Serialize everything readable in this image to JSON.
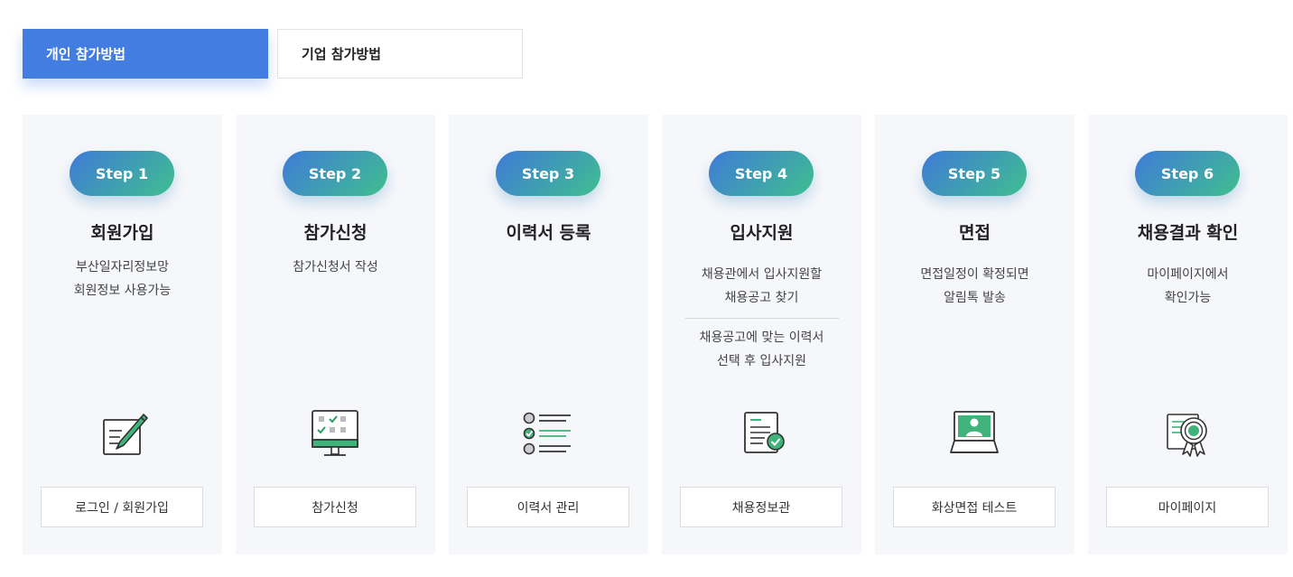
{
  "tabs": {
    "individual": "개인 참가방법",
    "company": "기업 참가방법"
  },
  "steps": [
    {
      "step": "Step 1",
      "title": "회원가입",
      "desc": [
        "부산일자리정보망",
        "회원정보 사용가능"
      ],
      "icon": "pencil-form-icon",
      "button": "로그인 / 회원가입"
    },
    {
      "step": "Step 2",
      "title": "참가신청",
      "desc": [
        "참가신청서 작성"
      ],
      "icon": "monitor-checklist-icon",
      "button": "참가신청"
    },
    {
      "step": "Step 3",
      "title": "이력서 등록",
      "desc": [],
      "icon": "checklist-icon",
      "button": "이력서 관리"
    },
    {
      "step": "Step 4",
      "title": "입사지원",
      "desc": [
        "채용관에서 입사지원할",
        "채용공고 찾기"
      ],
      "desc2": [
        "채용공고에 맞는 이력서",
        "선택 후 입사지원"
      ],
      "icon": "document-check-icon",
      "button": "채용정보관"
    },
    {
      "step": "Step 5",
      "title": "면접",
      "desc": [
        "면접일정이 확정되면",
        "알림톡 발송"
      ],
      "icon": "laptop-video-icon",
      "button": "화상면접 테스트"
    },
    {
      "step": "Step 6",
      "title": "채용결과 확인",
      "desc": [
        "마이페이지에서",
        "확인가능"
      ],
      "icon": "certificate-icon",
      "button": "마이페이지"
    }
  ],
  "colors": {
    "accent": "#437de1",
    "gradient_start": "#3f7ad8",
    "gradient_end": "#3fbf8f",
    "icon_green": "#3fb37a",
    "card_bg": "#f6f7fb"
  }
}
